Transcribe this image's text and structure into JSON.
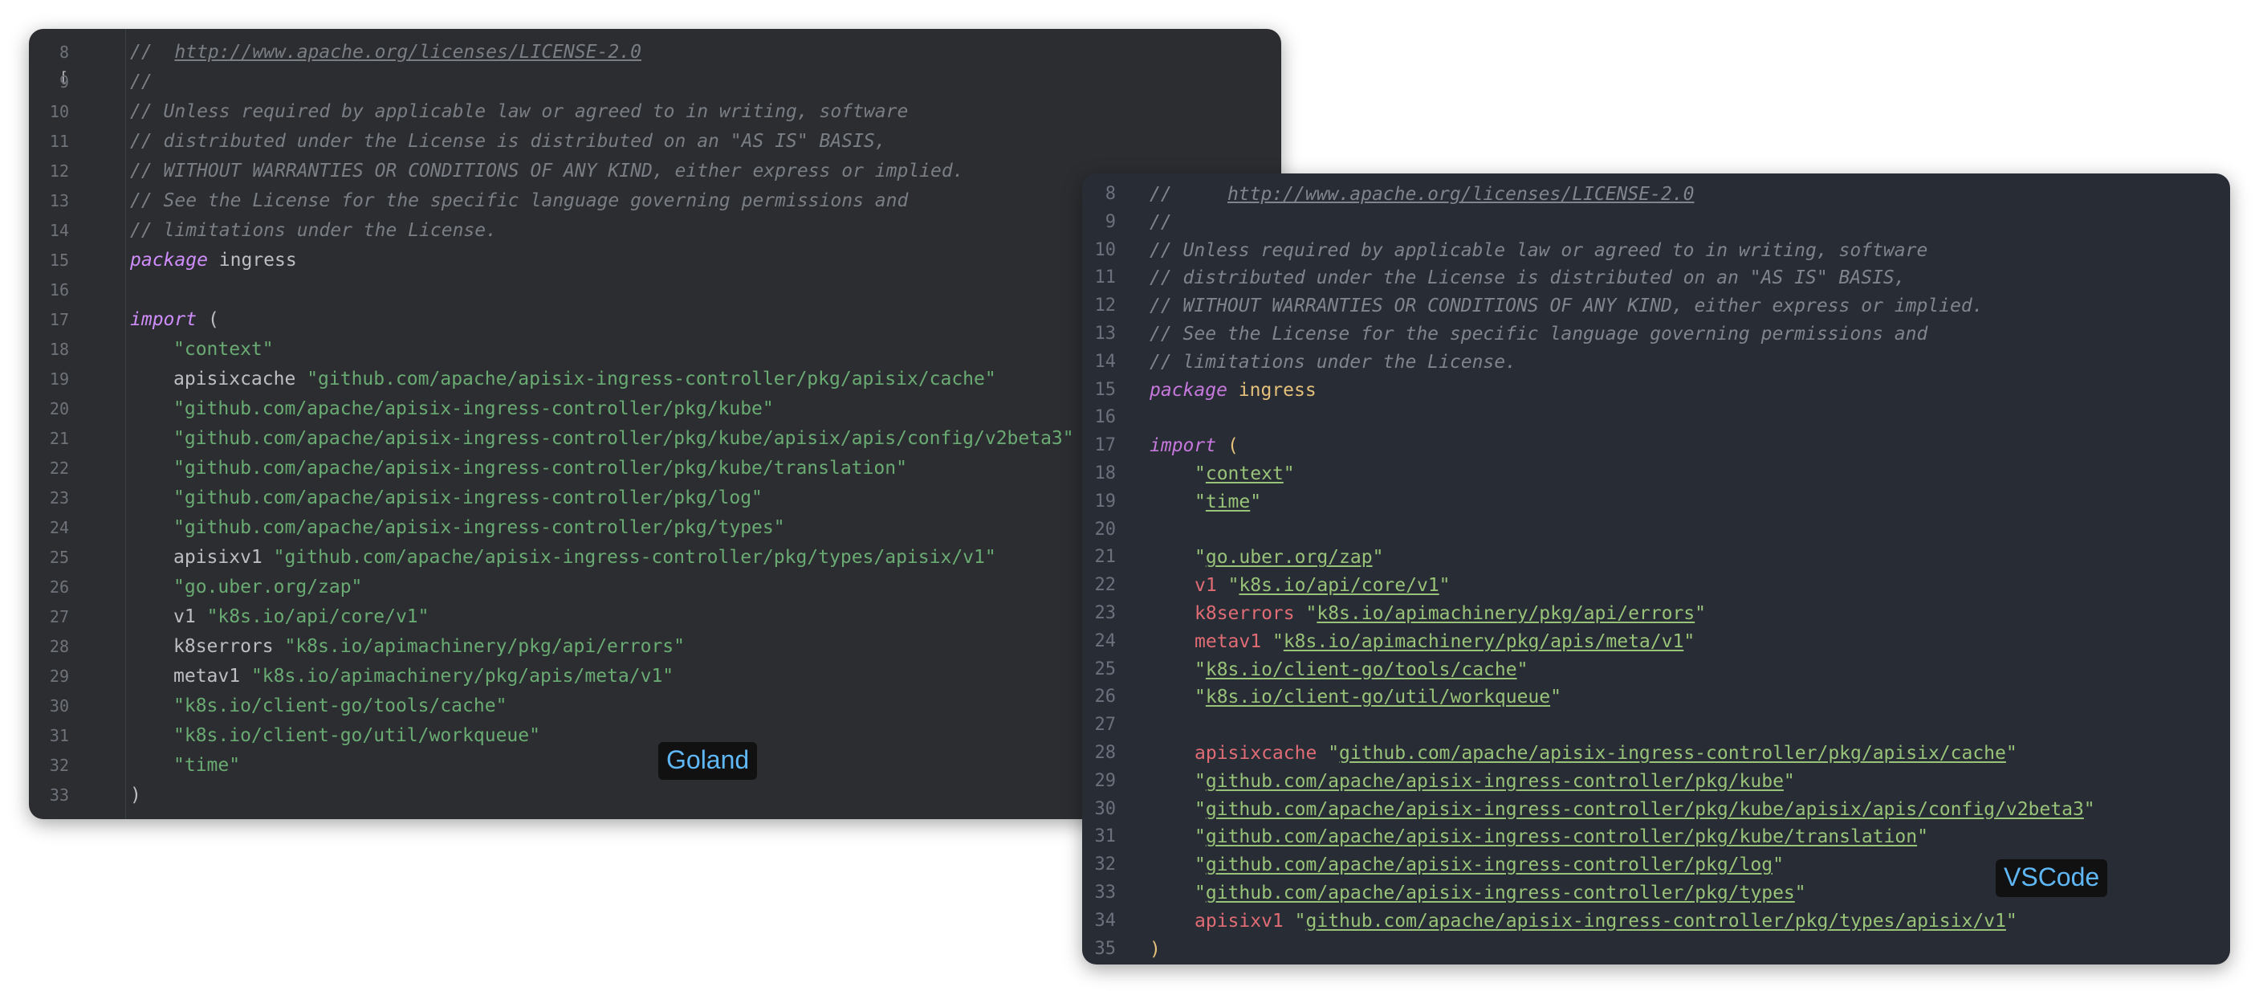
{
  "goland": {
    "label": "Goland",
    "lines": [
      {
        "n": "8",
        "type": "comment-link",
        "prefix": "//  ",
        "link": "http://www.apache.org/licenses/LICENSE-2.0"
      },
      {
        "n": "9",
        "type": "comment",
        "text": "//"
      },
      {
        "n": "10",
        "type": "comment",
        "text": "// Unless required by applicable law or agreed to in writing, software"
      },
      {
        "n": "11",
        "type": "comment",
        "text": "// distributed under the License is distributed on an \"AS IS\" BASIS,"
      },
      {
        "n": "12",
        "type": "comment",
        "text": "// WITHOUT WARRANTIES OR CONDITIONS OF ANY KIND, either express or implied."
      },
      {
        "n": "13",
        "type": "comment",
        "text": "// See the License for the specific language governing permissions and"
      },
      {
        "n": "14",
        "type": "comment",
        "text": "// limitations under the License."
      },
      {
        "n": "15",
        "type": "package",
        "kw": "package",
        "name": "ingress"
      },
      {
        "n": "16",
        "type": "blank"
      },
      {
        "n": "17",
        "type": "import",
        "kw": "import",
        "paren": "("
      },
      {
        "n": "18",
        "type": "str",
        "str": "\"context\""
      },
      {
        "n": "19",
        "type": "alias",
        "alias": "apisixcache",
        "str": "\"github.com/apache/apisix-ingress-controller/pkg/apisix/cache\""
      },
      {
        "n": "20",
        "type": "str",
        "str": "\"github.com/apache/apisix-ingress-controller/pkg/kube\""
      },
      {
        "n": "21",
        "type": "str",
        "str": "\"github.com/apache/apisix-ingress-controller/pkg/kube/apisix/apis/config/v2beta3\""
      },
      {
        "n": "22",
        "type": "str",
        "str": "\"github.com/apache/apisix-ingress-controller/pkg/kube/translation\""
      },
      {
        "n": "23",
        "type": "str",
        "str": "\"github.com/apache/apisix-ingress-controller/pkg/log\""
      },
      {
        "n": "24",
        "type": "str",
        "str": "\"github.com/apache/apisix-ingress-controller/pkg/types\""
      },
      {
        "n": "25",
        "type": "alias",
        "alias": "apisixv1",
        "str": "\"github.com/apache/apisix-ingress-controller/pkg/types/apisix/v1\""
      },
      {
        "n": "26",
        "type": "str",
        "str": "\"go.uber.org/zap\""
      },
      {
        "n": "27",
        "type": "alias",
        "alias": "v1",
        "str": "\"k8s.io/api/core/v1\""
      },
      {
        "n": "28",
        "type": "alias",
        "alias": "k8serrors",
        "str": "\"k8s.io/apimachinery/pkg/api/errors\""
      },
      {
        "n": "29",
        "type": "alias",
        "alias": "metav1",
        "str": "\"k8s.io/apimachinery/pkg/apis/meta/v1\""
      },
      {
        "n": "30",
        "type": "str",
        "str": "\"k8s.io/client-go/tools/cache\""
      },
      {
        "n": "31",
        "type": "str",
        "str": "\"k8s.io/client-go/util/workqueue\""
      },
      {
        "n": "32",
        "type": "str",
        "str": "\"time\""
      },
      {
        "n": "33",
        "type": "close",
        "paren": ")"
      }
    ]
  },
  "vscode": {
    "label": "VSCode",
    "lines": [
      {
        "n": "8",
        "type": "comment-link",
        "prefix": "//     ",
        "link": "http://www.apache.org/licenses/LICENSE-2.0"
      },
      {
        "n": "9",
        "type": "comment",
        "text": "//"
      },
      {
        "n": "10",
        "type": "comment",
        "text": "// Unless required by applicable law or agreed to in writing, software"
      },
      {
        "n": "11",
        "type": "comment",
        "text": "// distributed under the License is distributed on an \"AS IS\" BASIS,"
      },
      {
        "n": "12",
        "type": "comment",
        "text": "// WITHOUT WARRANTIES OR CONDITIONS OF ANY KIND, either express or implied."
      },
      {
        "n": "13",
        "type": "comment",
        "text": "// See the License for the specific language governing permissions and"
      },
      {
        "n": "14",
        "type": "comment",
        "text": "// limitations under the License."
      },
      {
        "n": "15",
        "type": "package",
        "kw": "package",
        "name": "ingress"
      },
      {
        "n": "16",
        "type": "blank"
      },
      {
        "n": "17",
        "type": "import",
        "kw": "import",
        "paren": "("
      },
      {
        "n": "18",
        "type": "str",
        "str": "context"
      },
      {
        "n": "19",
        "type": "str",
        "str": "time"
      },
      {
        "n": "20",
        "type": "blank"
      },
      {
        "n": "21",
        "type": "str",
        "str": "go.uber.org/zap"
      },
      {
        "n": "22",
        "type": "alias",
        "alias": "v1",
        "str": "k8s.io/api/core/v1"
      },
      {
        "n": "23",
        "type": "alias",
        "alias": "k8serrors",
        "str": "k8s.io/apimachinery/pkg/api/errors"
      },
      {
        "n": "24",
        "type": "alias",
        "alias": "metav1",
        "str": "k8s.io/apimachinery/pkg/apis/meta/v1"
      },
      {
        "n": "25",
        "type": "str",
        "str": "k8s.io/client-go/tools/cache"
      },
      {
        "n": "26",
        "type": "str",
        "str": "k8s.io/client-go/util/workqueue"
      },
      {
        "n": "27",
        "type": "blank"
      },
      {
        "n": "28",
        "type": "alias",
        "alias": "apisixcache",
        "str": "github.com/apache/apisix-ingress-controller/pkg/apisix/cache"
      },
      {
        "n": "29",
        "type": "str",
        "str": "github.com/apache/apisix-ingress-controller/pkg/kube"
      },
      {
        "n": "30",
        "type": "str",
        "str": "github.com/apache/apisix-ingress-controller/pkg/kube/apisix/apis/config/v2beta3"
      },
      {
        "n": "31",
        "type": "str",
        "str": "github.com/apache/apisix-ingress-controller/pkg/kube/translation"
      },
      {
        "n": "32",
        "type": "str",
        "str": "github.com/apache/apisix-ingress-controller/pkg/log"
      },
      {
        "n": "33",
        "type": "str",
        "str": "github.com/apache/apisix-ingress-controller/pkg/types"
      },
      {
        "n": "34",
        "type": "alias",
        "alias": "apisixv1",
        "str": "github.com/apache/apisix-ingress-controller/pkg/types/apisix/v1"
      },
      {
        "n": "35",
        "type": "close",
        "paren": ")"
      }
    ]
  },
  "colors": {
    "goland_bg": "#2b2d30",
    "vscode_bg": "#282c34",
    "badge_text": "#5fb8f5"
  }
}
